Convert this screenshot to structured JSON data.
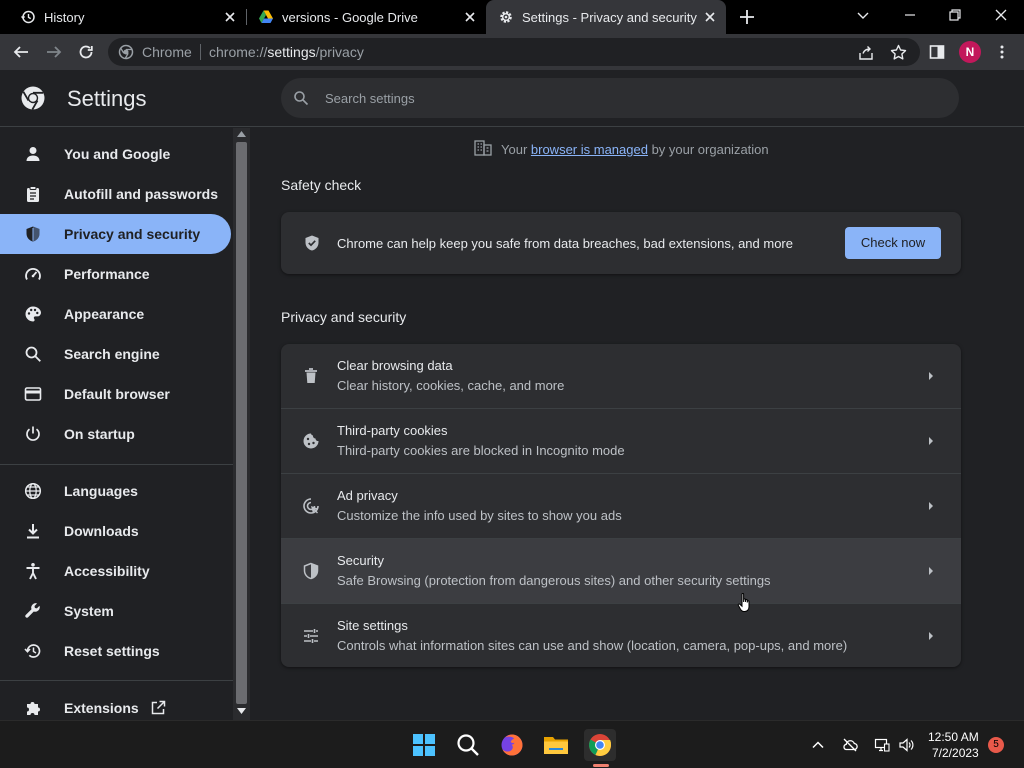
{
  "tabs": [
    {
      "title": "History",
      "icon": "history-icon",
      "active": false
    },
    {
      "title": "versions - Google Drive",
      "icon": "google-drive-icon",
      "active": false
    },
    {
      "title": "Settings - Privacy and security",
      "icon": "settings-gear-icon",
      "active": true
    }
  ],
  "omnibox": {
    "site_label": "Chrome",
    "url_prefix": "chrome://",
    "url_host": "settings",
    "url_path": "/privacy"
  },
  "profile": {
    "initial": "N",
    "color": "#c2185b"
  },
  "header": {
    "title": "Settings",
    "search_placeholder": "Search settings"
  },
  "sidebar": {
    "items": [
      {
        "label": "You and Google",
        "icon": "person-icon"
      },
      {
        "label": "Autofill and passwords",
        "icon": "clipboard-icon"
      },
      {
        "label": "Privacy and security",
        "icon": "shield-icon",
        "active": true
      },
      {
        "label": "Performance",
        "icon": "speedometer-icon"
      },
      {
        "label": "Appearance",
        "icon": "palette-icon"
      },
      {
        "label": "Search engine",
        "icon": "search-icon"
      },
      {
        "label": "Default browser",
        "icon": "browser-window-icon"
      },
      {
        "label": "On startup",
        "icon": "power-icon"
      },
      {
        "label": "Languages",
        "icon": "globe-icon"
      },
      {
        "label": "Downloads",
        "icon": "download-icon"
      },
      {
        "label": "Accessibility",
        "icon": "accessibility-icon"
      },
      {
        "label": "System",
        "icon": "wrench-icon"
      },
      {
        "label": "Reset settings",
        "icon": "restore-icon"
      }
    ],
    "extensions_label": "Extensions"
  },
  "managed": {
    "prefix": "Your ",
    "link": "browser is managed",
    "suffix": " by your organization"
  },
  "safety_check": {
    "title": "Safety check",
    "text": "Chrome can help keep you safe from data breaches, bad extensions, and more",
    "button": "Check now"
  },
  "privacy": {
    "title": "Privacy and security",
    "rows": [
      {
        "title": "Clear browsing data",
        "subtitle": "Clear history, cookies, cache, and more",
        "icon": "trash-icon"
      },
      {
        "title": "Third-party cookies",
        "subtitle": "Third-party cookies are blocked in Incognito mode",
        "icon": "cookie-icon"
      },
      {
        "title": "Ad privacy",
        "subtitle": "Customize the info used by sites to show you ads",
        "icon": "ad-privacy-icon"
      },
      {
        "title": "Security",
        "subtitle": "Safe Browsing (protection from dangerous sites) and other security settings",
        "icon": "shield-icon",
        "hover": true
      },
      {
        "title": "Site settings",
        "subtitle": "Controls what information sites can use and show (location, camera, pop-ups, and more)",
        "icon": "sliders-icon"
      }
    ]
  },
  "taskbar": {
    "apps": [
      "windows-start-icon",
      "search-icon",
      "firefox-icon",
      "file-explorer-icon",
      "chrome-icon"
    ],
    "time": "12:50 AM",
    "date": "7/2/2023",
    "notifications": "5"
  },
  "colors": {
    "accent": "#8ab4f8",
    "background": "#202124",
    "card": "#2d2e31"
  }
}
